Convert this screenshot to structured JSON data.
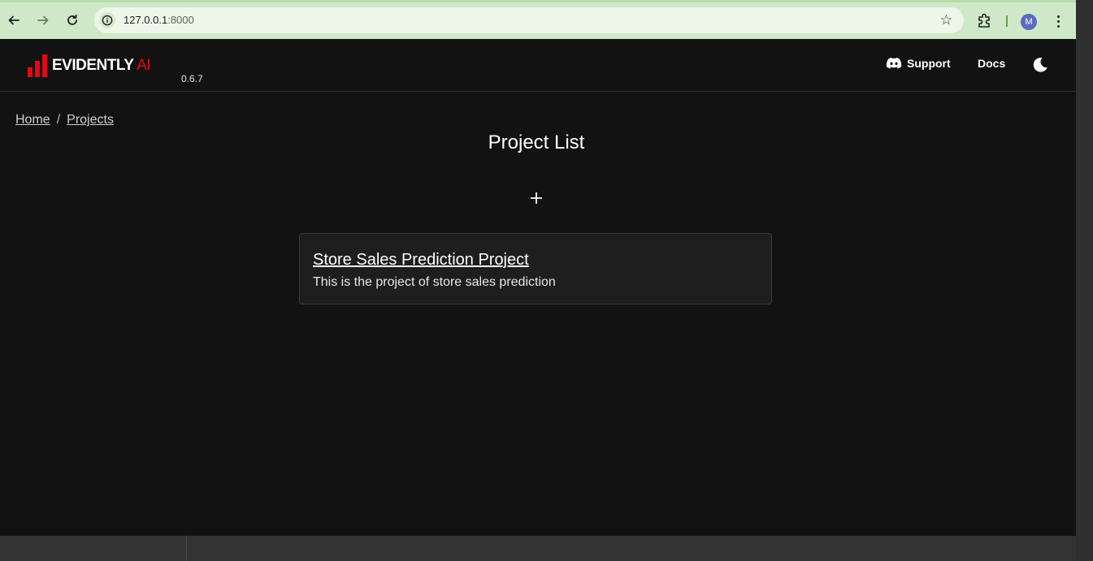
{
  "browser": {
    "url_host": "127.0.0.1",
    "url_port": ":8000",
    "profile_initial": "M"
  },
  "header": {
    "logo_main": "EVIDENTLY",
    "logo_ai": " AI",
    "version": "0.6.7",
    "support_label": "Support",
    "docs_label": "Docs"
  },
  "breadcrumb": {
    "home": "Home",
    "separator": "/",
    "projects": "Projects"
  },
  "page": {
    "title": "Project List"
  },
  "projects": [
    {
      "name": "Store Sales Prediction Project",
      "description": "This is the project of store sales prediction"
    }
  ],
  "colors": {
    "brand_red": "#e50914",
    "background": "#121212",
    "card_background": "#1e1e1e",
    "browser_toolbar": "#cfe9c8"
  }
}
